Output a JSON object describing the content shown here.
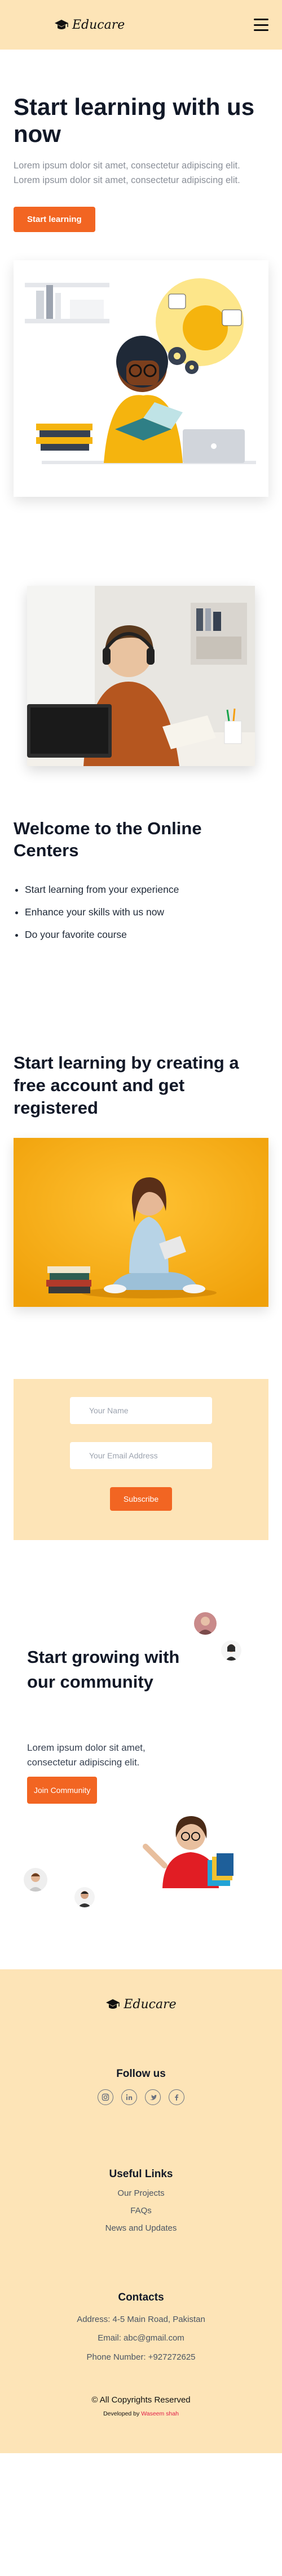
{
  "brand": {
    "name": "Educare"
  },
  "header": {
    "menu_icon": "hamburger-menu-icon"
  },
  "hero": {
    "title": "Start learning with us now",
    "text": "Lorem ipsum dolor sit amet, consectetur adipiscing elit. Lorem ipsum dolor sit amet, consectetur adipiscing elit.",
    "button": "Start learning"
  },
  "welcome": {
    "title": "Welcome to the Online Centers",
    "items": [
      "Start learning from your experience",
      "Enhance your skills with us now",
      "Do your favorite course"
    ]
  },
  "register": {
    "title": "Start learning by creating a free account and get registered"
  },
  "subscribe": {
    "name_placeholder": "Your Name",
    "email_placeholder": "Your Email Address",
    "button": "Subscribe"
  },
  "community": {
    "title": "Start growing with our community",
    "text": "Lorem ipsum dolor sit amet, consectetur adipiscing elit.",
    "button": "Join Community"
  },
  "footer": {
    "follow_title": "Follow us",
    "socials": [
      "instagram-icon",
      "linkedin-icon",
      "twitter-icon",
      "facebook-icon"
    ],
    "links_title": "Useful Links",
    "links": [
      "Our Projects",
      "FAQs",
      "News and Updates"
    ],
    "contacts_title": "Contacts",
    "address": "Address: 4-5 Main Road, Pakistan",
    "email": "Email: abc@gmail.com",
    "phone": "Phone Number: +927272625",
    "copyright": "© All Copyrights Reserved",
    "developed_by": "Developed by",
    "developer": "Waseem shah"
  },
  "colors": {
    "accent": "#f26522",
    "cream": "#fde4b7",
    "sun": "#f5b40e"
  }
}
